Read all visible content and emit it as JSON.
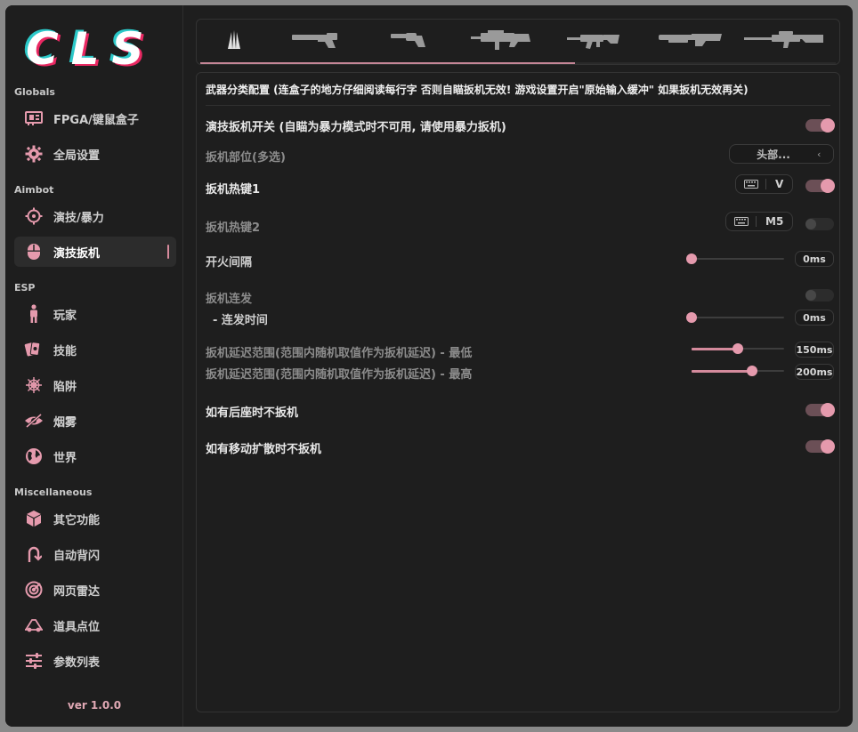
{
  "app": {
    "logo_text": "CLS",
    "version": "ver 1.0.0"
  },
  "sidebar": {
    "sections": [
      "Globals",
      "Aimbot",
      "ESP",
      "Miscellaneous"
    ],
    "items": [
      {
        "label": "FPGA/键鼠盒子",
        "icon": "fpga-card-icon"
      },
      {
        "label": "全局设置",
        "icon": "gear-icon"
      },
      {
        "label": "演技/暴力",
        "icon": "crosshair-icon"
      },
      {
        "label": "演技扳机",
        "icon": "mouse-icon",
        "active": true
      },
      {
        "label": "玩家",
        "icon": "person-icon"
      },
      {
        "label": "技能",
        "icon": "cards-icon"
      },
      {
        "label": "陷阱",
        "icon": "spiderweb-icon"
      },
      {
        "label": "烟雾",
        "icon": "eye-slash-icon"
      },
      {
        "label": "世界",
        "icon": "globe-icon"
      },
      {
        "label": "其它功能",
        "icon": "cube-icon"
      },
      {
        "label": "自动背闪",
        "icon": "u-turn-icon"
      },
      {
        "label": "网页雷达",
        "icon": "radar-icon"
      },
      {
        "label": "道具点位",
        "icon": "landmark-icon"
      },
      {
        "label": "参数列表",
        "icon": "sliders-icon"
      }
    ]
  },
  "weapon_tabs": {
    "icons": [
      "knife-claw-icon",
      "pistol-icon",
      "revolver-icon",
      "smg-icon",
      "rifle-icon",
      "shotgun-icon",
      "sniper-icon"
    ],
    "scroll_fraction": 0.59
  },
  "panel": {
    "header": "武器分类配置 (连盒子的地方仔细阅读每行字 否则自瞄扳机无效! 游戏设置开启\"原始输入缓冲\" 如果扳机无效再关)",
    "rows": {
      "trigger_toggle": {
        "label": "演技扳机开关 (自瞄为暴力模式时不可用, 请使用暴力扳机)",
        "enabled": true
      },
      "trigger_parts": {
        "label": "扳机部位(多选)",
        "value": "头部..."
      },
      "hotkey1": {
        "label": "扳机热键1",
        "key": "V",
        "enabled": true
      },
      "hotkey2": {
        "label": "扳机热键2",
        "key": "M5",
        "enabled": false
      },
      "fire_interval": {
        "label": "开火间隔",
        "value": "0ms",
        "fraction": 0.0
      },
      "burst": {
        "label": "扳机连发",
        "enabled": false
      },
      "burst_time": {
        "label": "- 连发时间",
        "value": "0ms",
        "fraction": 0.0
      },
      "delay_min": {
        "label": "扳机延迟范围(范围内随机取值作为扳机延迟) - 最低",
        "value": "150ms",
        "fraction": 0.5
      },
      "delay_max": {
        "label": "扳机延迟范围(范围内随机取值作为扳机延迟) - 最高",
        "value": "200ms",
        "fraction": 0.655
      },
      "no_trigger_recoil": {
        "label": "如有后座时不扳机",
        "enabled": true
      },
      "no_trigger_spread": {
        "label": "如有移动扩散时不扳机",
        "enabled": true
      }
    }
  },
  "colors": {
    "accent": "#e59aad",
    "accent_dim": "#6b4f56",
    "background": "#1e1e1e"
  }
}
